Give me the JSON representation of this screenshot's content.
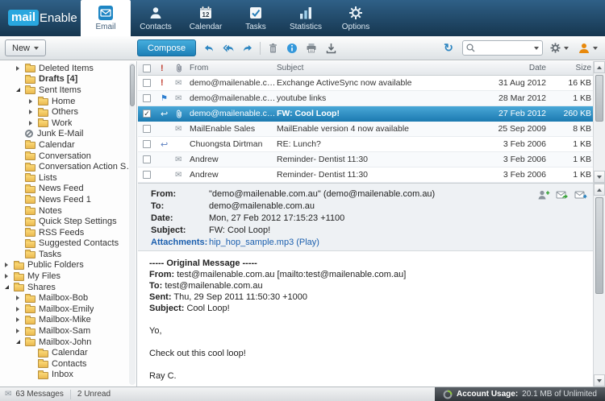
{
  "brand": {
    "mail": "mail",
    "enable": "Enable"
  },
  "tabs": [
    {
      "label": "Email"
    },
    {
      "label": "Contacts"
    },
    {
      "label": "Calendar",
      "badge": "12"
    },
    {
      "label": "Tasks"
    },
    {
      "label": "Statistics"
    },
    {
      "label": "Options"
    }
  ],
  "toolbar": {
    "new": "New",
    "compose": "Compose"
  },
  "icons": {
    "mail": "✉",
    "priority": "!",
    "flag": "⚑",
    "reply": "↩",
    "refresh": "↻"
  },
  "sidebar": {
    "items": [
      {
        "label": "Deleted Items"
      },
      {
        "label": "Drafts [4]"
      },
      {
        "label": "Sent Items"
      },
      {
        "label": "Home"
      },
      {
        "label": "Others"
      },
      {
        "label": "Work"
      },
      {
        "label": "Junk E-Mail"
      },
      {
        "label": "Calendar"
      },
      {
        "label": "Conversation"
      },
      {
        "label": "Conversation Action Settings"
      },
      {
        "label": "Lists"
      },
      {
        "label": "News Feed"
      },
      {
        "label": "News Feed 1"
      },
      {
        "label": "Notes"
      },
      {
        "label": "Quick Step Settings"
      },
      {
        "label": "RSS Feeds"
      },
      {
        "label": "Suggested Contacts"
      },
      {
        "label": "Tasks"
      },
      {
        "label": "Public Folders"
      },
      {
        "label": "My Files"
      },
      {
        "label": "Shares"
      },
      {
        "label": "Mailbox-Bob"
      },
      {
        "label": "Mailbox-Emily"
      },
      {
        "label": "Mailbox-Mike"
      },
      {
        "label": "Mailbox-Sam"
      },
      {
        "label": "Mailbox-John"
      },
      {
        "label": "Calendar"
      },
      {
        "label": "Contacts"
      },
      {
        "label": "Inbox"
      }
    ]
  },
  "list": {
    "columns": {
      "from": "From",
      "subject": "Subject",
      "date": "Date",
      "size": "Size"
    },
    "rows": [
      {
        "from": "demo@mailenable.com.au",
        "subject": "Exchange ActiveSync now available",
        "date": "31 Aug 2012",
        "size": "16 KB"
      },
      {
        "from": "demo@mailenable.com.au",
        "subject": "youtube links",
        "date": "28 Mar 2012",
        "size": "1 KB"
      },
      {
        "from": "demo@mailenable.com.au",
        "subject": "FW: Cool Loop!",
        "date": "27 Feb 2012",
        "size": "260 KB"
      },
      {
        "from": "MailEnable Sales",
        "subject": "MailEnable version 4 now available",
        "date": "25 Sep 2009",
        "size": "8 KB"
      },
      {
        "from": "Chuongsta Dirtman",
        "subject": "RE: Lunch?",
        "date": "3 Feb 2006",
        "size": "1 KB"
      },
      {
        "from": "Andrew",
        "subject": "Reminder- Dentist 11:30",
        "date": "3 Feb 2006",
        "size": "1 KB"
      },
      {
        "from": "Andrew",
        "subject": "Reminder- Dentist 11:30",
        "date": "3 Feb 2006",
        "size": "1 KB"
      }
    ]
  },
  "preview": {
    "from_label": "From:",
    "from": "\"demo@mailenable.com.au\" (demo@mailenable.com.au)",
    "to_label": "To:",
    "to": "demo@mailenable.com.au",
    "date_label": "Date:",
    "date": "Mon, 27 Feb 2012 17:15:23 +1100",
    "subject_label": "Subject:",
    "subject": "FW: Cool Loop!",
    "attachments_label": "Attachments:",
    "attachments": "hip_hop_sample.mp3 (Play)",
    "body": [
      {
        "b": "----- Original Message -----",
        "t": ""
      },
      {
        "b": "From:",
        "t": " test@mailenable.com.au [mailto:test@mailenable.com.au]"
      },
      {
        "b": "To:",
        "t": " test@mailenable.com.au"
      },
      {
        "b": "Sent:",
        "t": " Thu, 29 Sep 2011 11:50:30 +1000"
      },
      {
        "b": "Subject:",
        "t": " Cool Loop!"
      },
      {
        "b": "",
        "t": ""
      },
      {
        "b": "",
        "t": "Yo,"
      },
      {
        "b": "",
        "t": ""
      },
      {
        "b": "",
        "t": "Check out this cool loop!"
      },
      {
        "b": "",
        "t": ""
      },
      {
        "b": "",
        "t": "Ray C."
      }
    ]
  },
  "status": {
    "messages": "63 Messages",
    "unread": "2 Unread",
    "usage_label": "Account Usage:",
    "usage_value": " 20.1 MB of Unlimited"
  },
  "colors": {
    "accent": "#1e7fb6",
    "selected_row": "#1e7cb2",
    "topbar": "#16364f",
    "flag": "#2f7fd0",
    "priority": "#c0392b",
    "link": "#1b5fae"
  }
}
